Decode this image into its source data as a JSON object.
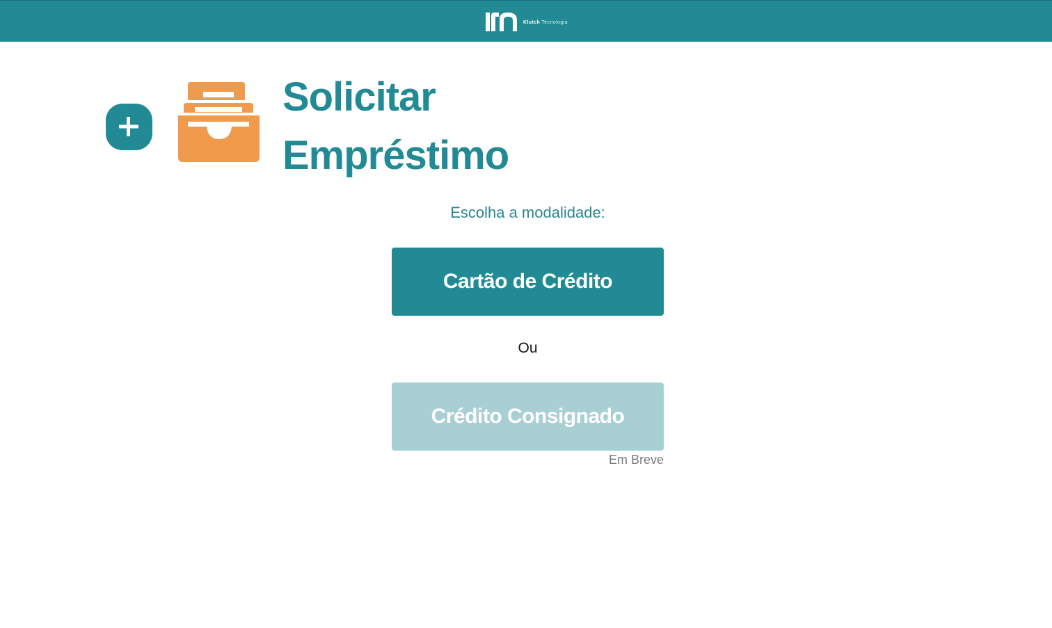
{
  "header": {
    "logo_icon": "klutch-logo-icon",
    "brand_name": "Klutch",
    "brand_suffix": "Tecnologia",
    "background_color": "#228a94"
  },
  "main": {
    "add_button_icon": "plus-icon",
    "hero_icon": "inbox-archive-icon",
    "title_line1": "Solicitar",
    "title_line2": "Empréstimo",
    "prompt": "Escolha a modalidade:",
    "option_primary_label": "Cartão de Crédito",
    "separator": "Ou",
    "option_secondary_label": "Crédito Consignado",
    "option_secondary_note": "Em Breve"
  },
  "colors": {
    "accent": "#228a94",
    "icon_orange": "#f09b4c",
    "disabled_button": "#a8d0d4",
    "note_text": "#7a7a7a"
  }
}
